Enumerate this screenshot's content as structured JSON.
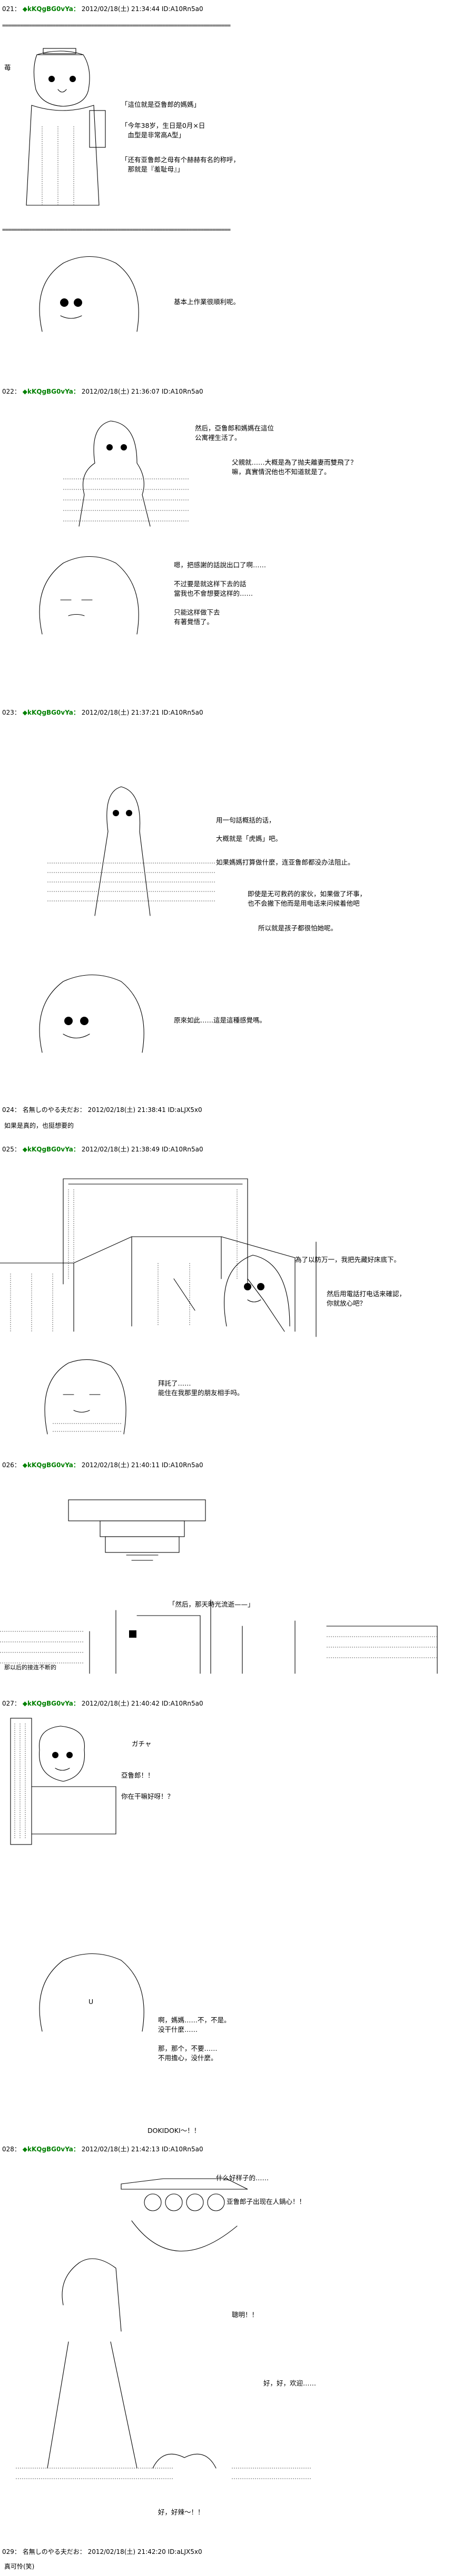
{
  "posts": [
    {
      "id": "p021",
      "header": {
        "num": "021：",
        "name": "◆kKQgBG0vYa：",
        "date": "2012/02/18(土) 21:34:44 ID:A10Rn5a0"
      }
    },
    {
      "id": "p022",
      "header": {
        "num": "022：",
        "name": "◆kKQgBG0vYa：",
        "date": "2012/02/18(土) 21:36:07 ID:A10Rn5a0"
      }
    },
    {
      "id": "p023",
      "header": {
        "num": "023：",
        "name": "◆kKQgBG0vYa：",
        "date": "2012/02/18(土) 21:37:21 ID:A10Rn5a0"
      }
    },
    {
      "id": "p024",
      "header": {
        "num": "024：",
        "name": "名無しのやる夫だお：",
        "date": "2012/02/18(土) 21:38:41 ID:aLJX5x0"
      },
      "reply": "如果是真的，也挺想要的"
    },
    {
      "id": "p025",
      "header": {
        "num": "025：",
        "name": "◆kKQgBG0vYa：",
        "date": "2012/02/18(土) 21:38:49 ID:A10Rn5a0"
      }
    },
    {
      "id": "p026",
      "header": {
        "num": "026：",
        "name": "◆kKQgBG0vYa：",
        "date": "2012/02/18(土) 21:40:11 ID:A10Rn5a0"
      }
    },
    {
      "id": "p027",
      "header": {
        "num": "027：",
        "name": "◆kKQgBG0vYa：",
        "date": "2012/02/18(土) 21:40:42 ID:A10Rn5a0"
      }
    },
    {
      "id": "p028",
      "header": {
        "num": "028：",
        "name": "◆kKQgBG0vYa：",
        "date": "2012/02/18(土) 21:42:13 ID:A10Rn5a0"
      }
    },
    {
      "id": "p029",
      "header": {
        "num": "029：",
        "name": "名無しのやる夫だお：",
        "date": "2012/02/18(土) 21:42:20 ID:aLJX5x0"
      },
      "reply": "真可怜(笑)"
    }
  ],
  "separator": "=============================================================================",
  "dialog": {
    "p021_a": "「這位就是亞鲁郎的媽媽」",
    "p021_b": "「今年38岁，生日是0月×日\n　血型是非常高A型」",
    "p021_c": "「还有亚鲁郎之母有个赫赫有名的称呼，\n　那就是『羞耻母』」",
    "p022_a": "基本上作業很順利呢。",
    "p022_b": "然后，亞鲁郎和媽媽在這位\n公寓裡生活了。",
    "p022_c": "父親就……大概是為了抛夫離妻而雙飛了？\n嘛，真實情況他也不知道就是了。",
    "p022_d": "嗯，把感謝的話說出口了啊……\n\n不过要是就这样下去的話\n當我也不會想要这样的……\n\n只能这样做下去\n有著覺悟了。",
    "p023_a": "用一句話概括的话，",
    "p023_b": "大概就是「虎媽」吧。",
    "p023_c": "如果媽媽打算做什麼，连亚鲁郎都没办法阻止。",
    "p023_d": "即使是无可救药的家伙，如果做了坏事，\n也不会撇下他而是用电话来问候着他吧",
    "p023_e": "所以就是孩子都很怕她呢。",
    "p023_f": "原來如此……這是這種感覺嗎。",
    "p025_a": "為了以防万一，我把先藏好床底下。",
    "p025_b": "然后用電話打电话来確認，\n你就放心吧？",
    "p025_c": "拜託了……\n能住在我那里的朋友相手吗。",
    "p026_a": "「然后，那天時光流逝——」",
    "p026_b": "那以后的接连不断的",
    "p027_a": "ガチャ",
    "p027_b": "亞鲁郎！！",
    "p027_c": "你在干嘛好呀！？",
    "p028_a": "U",
    "p028_b": "啊，媽媽……不，不是。\n没干什麼……\n\n那，那个，不要……\n不用擔心，没什麼。",
    "p028_c": "DOKIDOKI〜！！",
    "p028_d": "什么好样子的……",
    "p028_e": "亚鲁郎子出现在人鍋心！！",
    "p028_f": "聰明！！",
    "p028_g": "好，好，欢迎……",
    "p028_h": "好，好辣〜！！"
  },
  "scene": {
    "sign_text": "什么好样子的……",
    "tag_text": "苺"
  }
}
